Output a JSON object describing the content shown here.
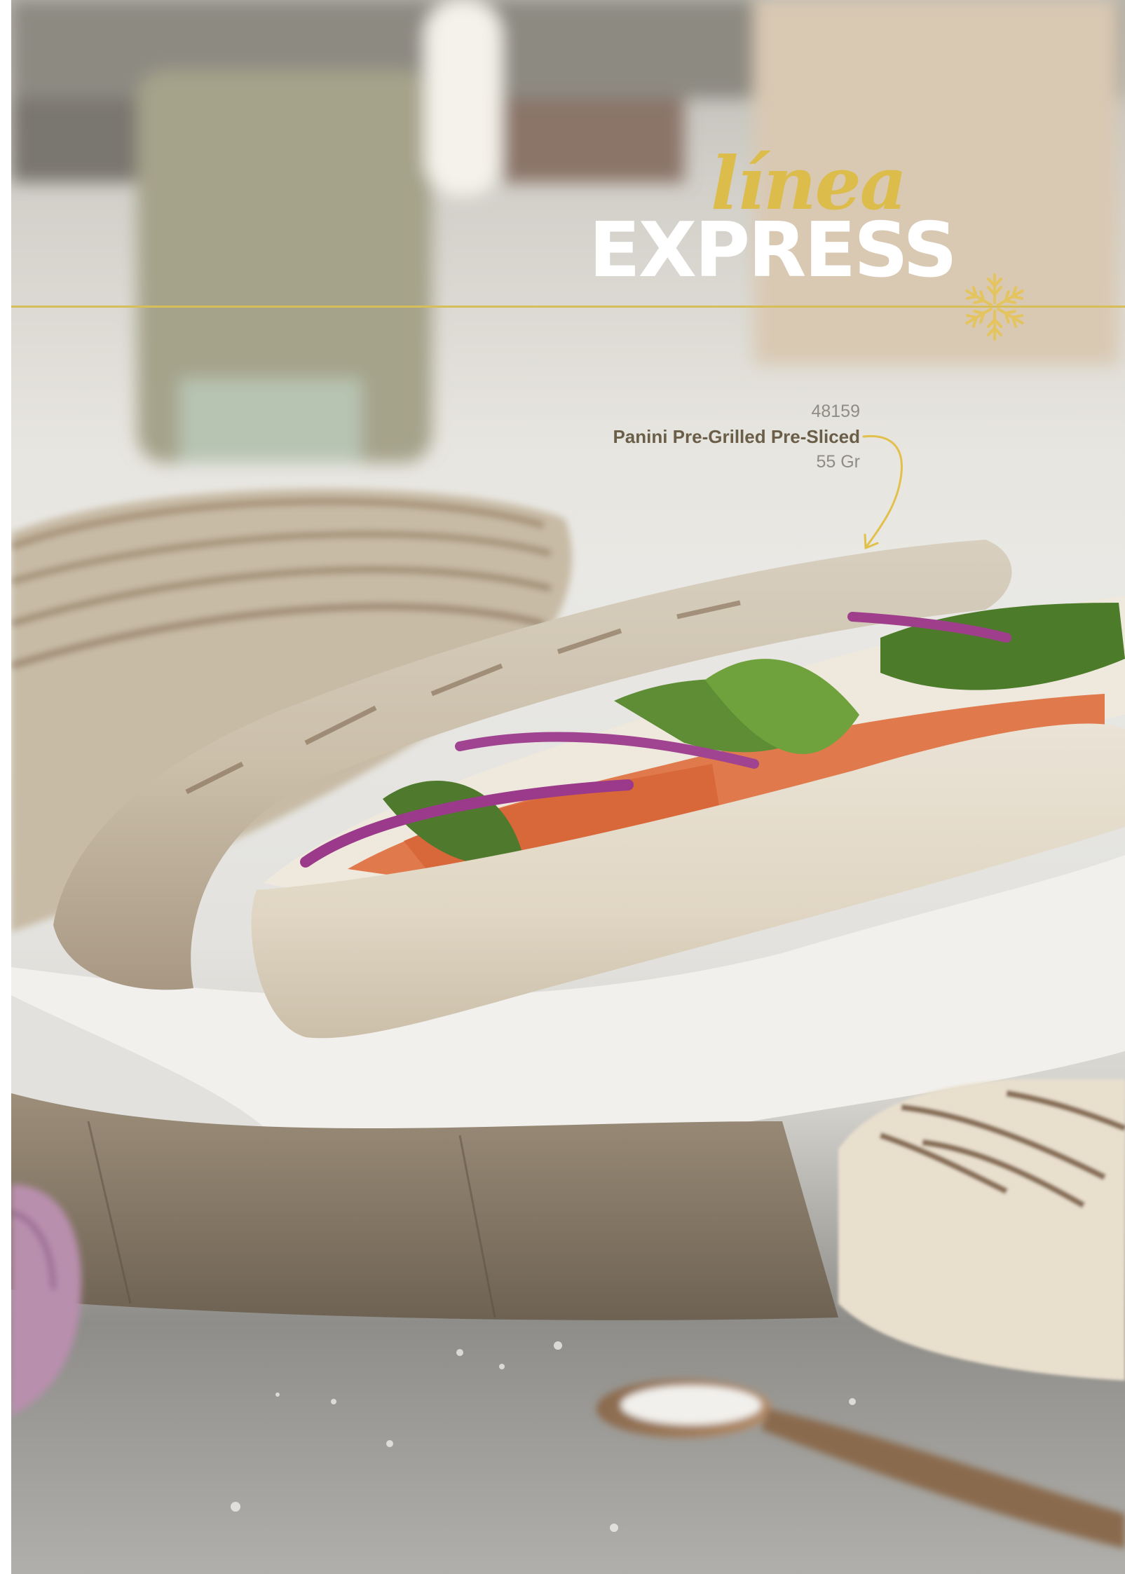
{
  "brand": {
    "script_text": "línea",
    "main_text": "EXPRESS",
    "script_color": "#dcbc4a",
    "main_color": "#ffffff",
    "rule_color": "#d8be58",
    "emblem_icon": "wheat-star-emblem"
  },
  "product": {
    "code": "48159",
    "name": "Panini Pre-Grilled Pre-Sliced",
    "weight": "55 Gr",
    "name_color": "#6a5e49",
    "pointer_icon": "curved-arrow-icon"
  },
  "photo": {
    "subject_icon": "panini-sandwich-photo"
  }
}
